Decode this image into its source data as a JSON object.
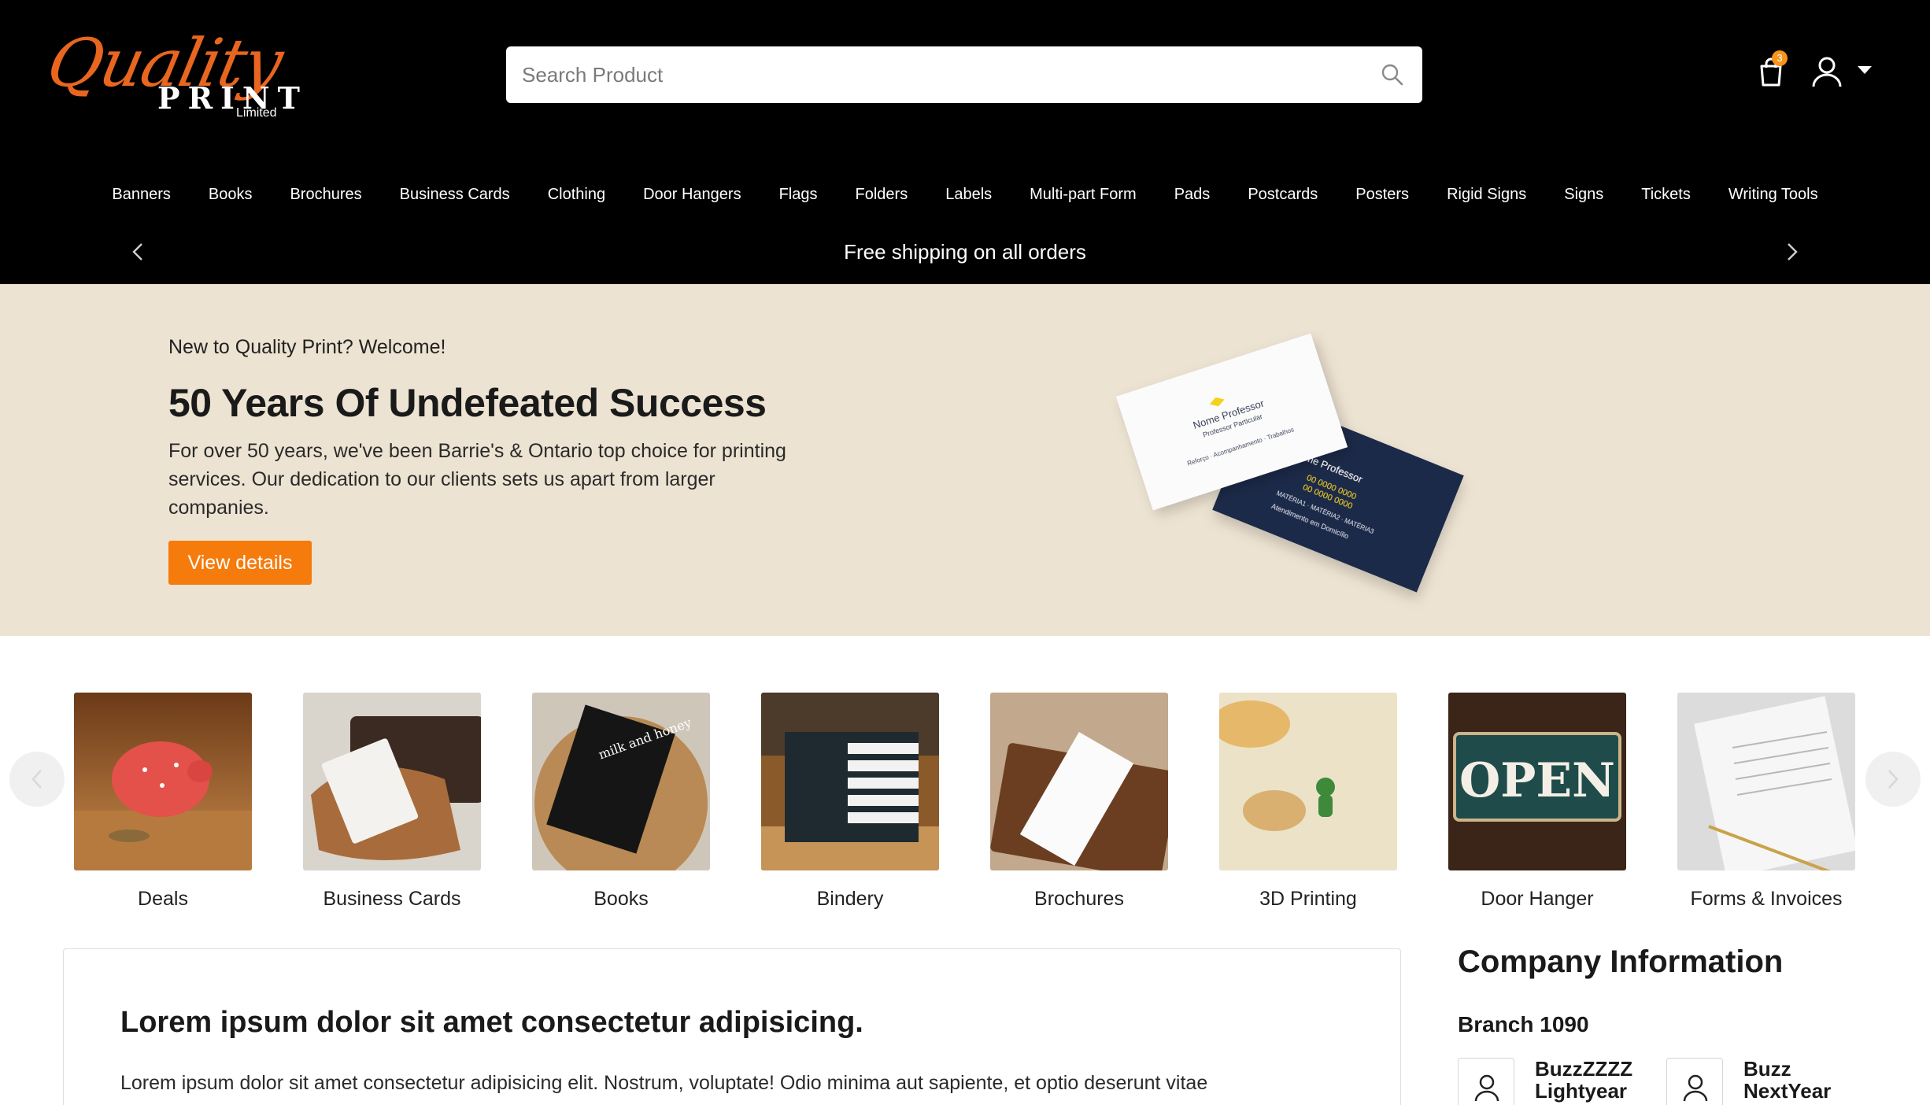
{
  "logo": {
    "script": "Quality",
    "word": "PRINT",
    "suffix": "Limited"
  },
  "search": {
    "placeholder": "Search Product"
  },
  "cart": {
    "count": "3"
  },
  "nav": [
    "Banners",
    "Books",
    "Brochures",
    "Business Cards",
    "Clothing",
    "Door Hangers",
    "Flags",
    "Folders",
    "Labels",
    "Multi-part Form",
    "Pads",
    "Postcards",
    "Posters",
    "Rigid Signs",
    "Signs",
    "Tickets",
    "Writing Tools"
  ],
  "promo": {
    "text": "Free shipping on all orders"
  },
  "hero": {
    "eyebrow": "New to Quality Print? Welcome!",
    "title": "50 Years Of Undefeated Success",
    "description": "For over 50 years, we've been Barrie's & Ontario top choice for printing services. Our dedication to our clients sets us apart from larger companies.",
    "cta": "View details",
    "card_white": {
      "name": "Nome Professor",
      "sub": "Professor Particular",
      "tags": "Reforço · Acompanhamento · Trabalhos"
    },
    "card_navy": {
      "name": "Nome Professor",
      "phone1": "00 0000 0000",
      "phone2": "00 0000 0000",
      "tags": "MATÉRIA1 · MATÉRIA2 · MATÉRIA3",
      "service": "Atendimento em Domicílio"
    }
  },
  "categories": [
    "Deals",
    "Business Cards",
    "Books",
    "Bindery",
    "Brochures",
    "3D Printing",
    "Door Hanger",
    "Forms & Invoices"
  ],
  "category_images": {
    "door_hanger_sign": "OPEN",
    "book_cover": "milk and honey"
  },
  "article": {
    "title": "Lorem ipsum dolor sit amet consectetur adipisicing.",
    "body": "Lorem ipsum dolor sit amet consectetur adipisicing elit. Nostrum, voluptate! Odio minima aut sapiente, et optio deserunt vitae"
  },
  "company": {
    "title": "Company Information",
    "branch": "Branch 1090",
    "people": [
      {
        "first": "BuzzZZZZ",
        "last": "Lightyear"
      },
      {
        "first": "Buzz",
        "last": "NextYear"
      }
    ]
  },
  "colors": {
    "accent": "#f57b0d",
    "header": "#000000",
    "hero_bg": "#ede3d2"
  }
}
